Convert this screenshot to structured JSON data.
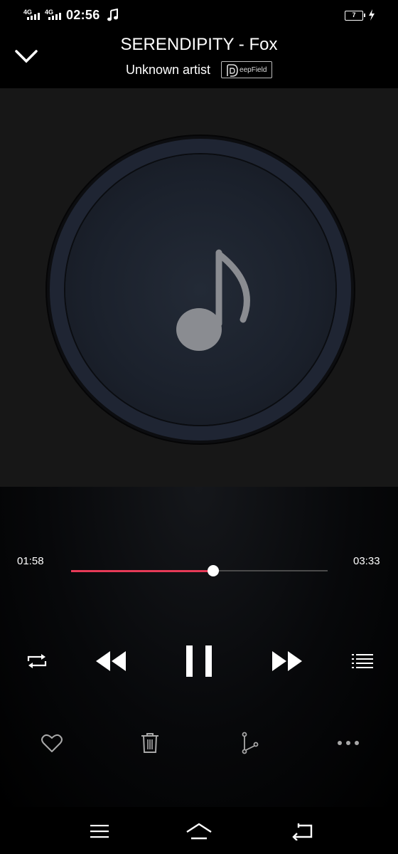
{
  "status_bar": {
    "network_1": "4G",
    "network_2": "4G",
    "time": "02:56",
    "music_icon": "music-note-icon",
    "battery_level": "7",
    "charging_icon": "lightning-icon"
  },
  "header": {
    "collapse_icon": "chevron-down-icon",
    "title": "SERENDIPITY - Fox",
    "artist": "Unknown artist",
    "sound_effect_badge": "eepField"
  },
  "album_art": {
    "icon": "music-note-icon"
  },
  "progress": {
    "current_time": "01:58",
    "total_time": "03:33",
    "fraction": 0.553,
    "played_color": "#e63a57"
  },
  "controls": {
    "repeat_icon": "repeat-icon",
    "previous_icon": "rewind-icon",
    "play_state_icon": "pause-icon",
    "next_icon": "fast-forward-icon",
    "playlist_icon": "playlist-icon"
  },
  "actions": {
    "favorite_icon": "heart-icon",
    "delete_icon": "trash-icon",
    "share_icon": "share-icon",
    "more_icon": "more-icon"
  },
  "nav_bar": {
    "menu_icon": "menu-icon",
    "home_icon": "home-icon",
    "back_icon": "back-icon"
  }
}
